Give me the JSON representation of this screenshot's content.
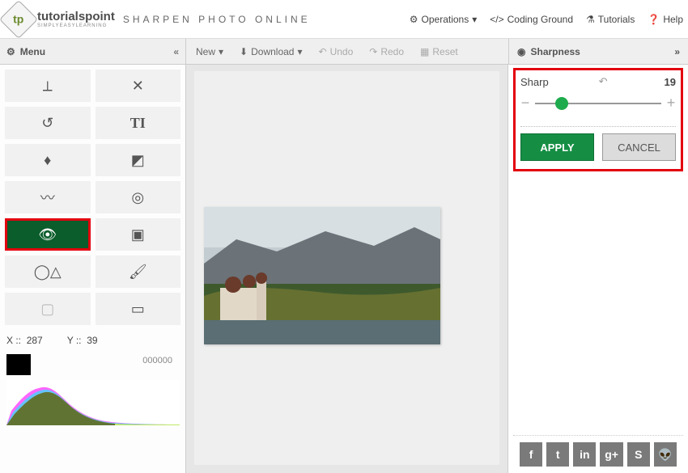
{
  "header": {
    "brand": "tutorialspoint",
    "brand_sub": "SIMPLYEASYLEARNING",
    "page_title": "SHARPEN PHOTO ONLINE",
    "nav": {
      "operations": "Operations",
      "coding_ground": "Coding Ground",
      "tutorials": "Tutorials",
      "help": "Help"
    }
  },
  "toolbar": {
    "menu": "Menu",
    "new": "New",
    "download": "Download",
    "undo": "Undo",
    "redo": "Redo",
    "reset": "Reset",
    "sharpness": "Sharpness"
  },
  "sidebar": {
    "tools": {
      "crop": "crop-icon",
      "fit": "fit-icon",
      "rotate": "rotate-icon",
      "text": "text-icon",
      "blur": "blur-icon",
      "levels": "levels-icon",
      "sharpen": "sharpen-icon",
      "target": "target-icon",
      "eye": "eye-icon",
      "image": "image-icon",
      "shape": "shape-icon",
      "brush": "brush-icon",
      "bounds": "bounds-icon",
      "frame": "frame-icon"
    },
    "coords": {
      "x_label": "X ::",
      "x": "287",
      "y_label": "Y ::",
      "y": "39"
    },
    "histo_label": "000000"
  },
  "panel": {
    "label": "Sharp",
    "value": "19",
    "apply": "APPLY",
    "cancel": "CANCEL",
    "slider_percent": 16
  },
  "social": {
    "fb": "f",
    "tw": "t",
    "li": "in",
    "gp": "g+",
    "su": "S",
    "rd": "👽"
  }
}
